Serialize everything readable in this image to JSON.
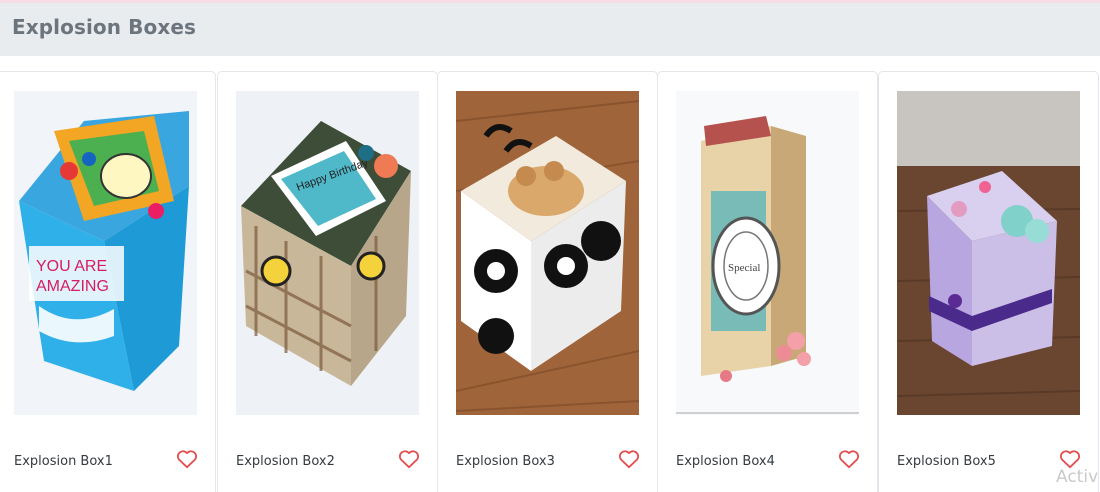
{
  "page": {
    "title": "Explosion Boxes"
  },
  "products": [
    {
      "name": "Explosion Box1",
      "image_icon": "explosion-box-photo"
    },
    {
      "name": "Explosion Box2",
      "image_icon": "explosion-box-photo"
    },
    {
      "name": "Explosion Box3",
      "image_icon": "explosion-box-photo"
    },
    {
      "name": "Explosion Box4",
      "image_icon": "explosion-box-photo"
    },
    {
      "name": "Explosion Box5",
      "image_icon": "explosion-box-photo"
    }
  ],
  "favorite_icon": "heart-outline-icon",
  "colors": {
    "accent": "#e05252",
    "header_bg": "#e9ecef",
    "header_text": "#6c757d"
  },
  "overlay": {
    "watermark": "Activ"
  }
}
